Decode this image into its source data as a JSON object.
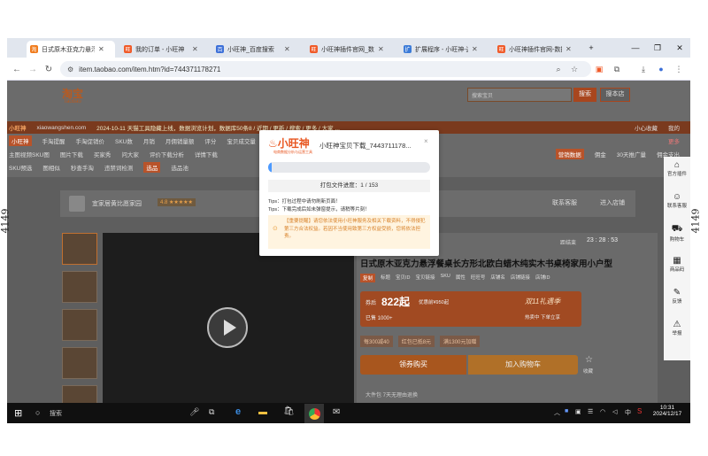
{
  "browser": {
    "tabs": [
      {
        "title": "日式原木亚克力悬浮",
        "color": "#f07a1a",
        "glyph": "淘"
      },
      {
        "title": "我的订单 - 小旺神",
        "color": "#f05a28",
        "glyph": "旺"
      },
      {
        "title": "小旺神_百度搜索",
        "color": "#3b6fd8",
        "glyph": "百"
      },
      {
        "title": "小旺神插件官网_数据",
        "color": "#f05a28",
        "glyph": "旺"
      },
      {
        "title": "扩展程序 - 小旺神-这",
        "color": "#3b7bd8",
        "glyph": "扩"
      },
      {
        "title": "小旺神插件官网-数据",
        "color": "#f05a28",
        "glyph": "旺"
      }
    ],
    "url": "item.taobao.com/item.htm?id=744371178271"
  },
  "page": {
    "logo": "淘宝",
    "logo_sub": "Taobao",
    "search_placeholder": "搜索宝贝",
    "search_btn": "搜索",
    "search_shop_btn": "搜本店",
    "plugin_brand": "小旺神",
    "plugin_domain": "xiaowangshen.com",
    "notice": "2024-10-11 天猫工具隐藏上线，数据浏览计划，数据库50条8 / 近期 / 更新 / 搜索 / 更多 / 大家 ...",
    "row2": [
      "手淘提醒",
      "手淘促销价",
      "SKU数",
      "月销",
      "月佣销量额",
      "评分",
      "宝贝成交量"
    ],
    "row3": [
      "主图视频SKU图",
      "图片下载",
      "买家秀",
      "问大家",
      "评价下载分析",
      "详情下载"
    ],
    "row4": [
      "SKU预选",
      "图相似",
      "秒查手淘",
      "违禁词检测",
      "选品",
      "选品池"
    ],
    "right_links": [
      "小心收藏",
      "我的"
    ],
    "more_label": "更多",
    "row_right": [
      "营销数据",
      "佣金",
      "30天推广量",
      "佣金支出"
    ],
    "shop_name": "宜家居黄比愿家园",
    "shop_rating": "4.8 ★★★★★",
    "shop_contact": "联系客服",
    "shop_enter": "进入店铺",
    "countdown_label": "距结束",
    "countdown": "23 : 28 : 53",
    "product_title": "日式原木亚克力悬浮餐桌长方形北欧白蜡木纯实木书桌椅家用小户型",
    "product_tags": [
      "复制",
      "标题",
      "宝贝ID",
      "宝贝链接",
      "SKU",
      "属性",
      "旺旺号",
      "店铺名",
      "店铺链接",
      "店铺ID"
    ],
    "price_label": "券后",
    "price": "822起",
    "price_orig": "优惠前¥950起",
    "sold": "已售 1000+",
    "promo_title": "双11礼遇季",
    "promo_sub": "热卖中 下单立享",
    "coupons": [
      "每300减40",
      "红包已抵8元",
      "满1300元加赠"
    ],
    "buy_btn": "领券购买",
    "cart_btn": "加入购物车",
    "fav_label": "收藏",
    "bottom_hint": "大件包 7天无理由退换",
    "rightbar": [
      {
        "icon": "home-icon",
        "glyph": "⌂",
        "label": "官方插件"
      },
      {
        "icon": "service-icon",
        "glyph": "☺",
        "label": "联系客服"
      },
      {
        "icon": "cart-icon",
        "glyph": "⛟",
        "label": "购物车"
      },
      {
        "icon": "grid-icon",
        "glyph": "▦",
        "label": "商品码"
      },
      {
        "icon": "edit-icon",
        "glyph": "✎",
        "label": "反馈"
      },
      {
        "icon": "warning-icon",
        "glyph": "⚠",
        "label": "举报"
      }
    ]
  },
  "modal": {
    "brand": "小旺神",
    "brand_sub": "电商数据分析与运营工具",
    "title": "小旺神宝贝下载_7443711178...",
    "progress_text": "打包文件进度：1 / 153",
    "progress_value": 0.0065,
    "tip1": "Tips：打包过程中请勿刷新页面！",
    "tip2": "Tips：下载完成后如未弹窗提示，请稍等片刻！",
    "warn": "【重要提醒】请您依法使用小旺神服务及相关下载资料，不得侵犯第三方合法权益。若因不当使用致第三方权益受损，您将依法担责。"
  },
  "taskbar": {
    "search": "搜索",
    "time": "10:31",
    "date": "2024/12/17",
    "ime": "中"
  },
  "sidenote": "4149"
}
